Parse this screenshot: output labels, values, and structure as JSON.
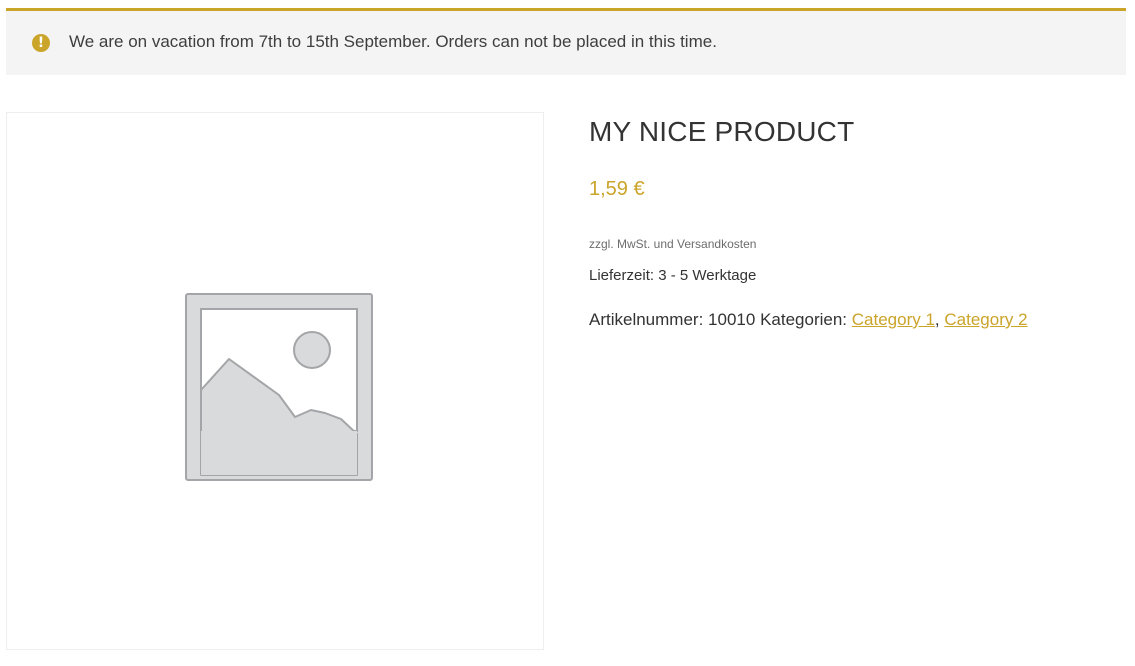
{
  "notice": {
    "icon": "exclamation-circle-icon",
    "icon_glyph": "!",
    "text": "We are on vacation from 7th to 15th September. Orders can not be placed in this time.",
    "accent_color": "#cba42a"
  },
  "gallery": {
    "image": "image-placeholder-icon"
  },
  "product": {
    "title": "MY NICE PRODUCT",
    "price": "1,59 €",
    "tax_note": "zzgl. MwSt. und Versandkosten",
    "delivery_label": "Lieferzeit:",
    "delivery_value": "3 - 5 Werktage",
    "sku_label": "Artikelnummer:",
    "sku_value": "10010",
    "categories_label": "Kategorien:",
    "categories": [
      "Category 1",
      "Category 2"
    ],
    "category_separator": ","
  }
}
